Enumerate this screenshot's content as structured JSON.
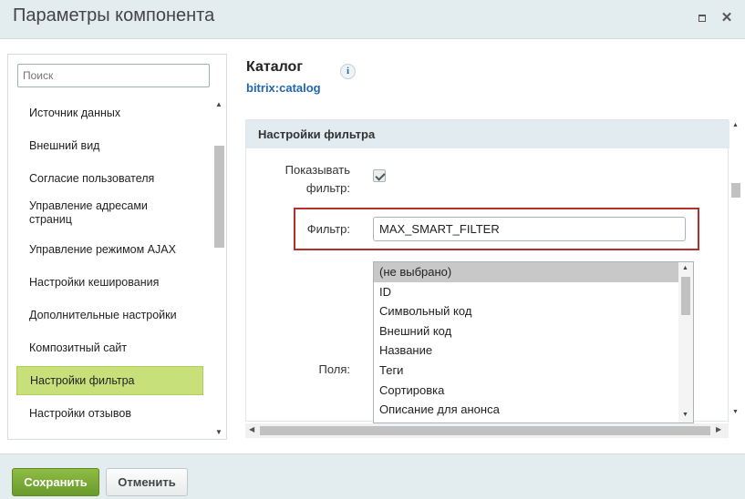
{
  "window": {
    "title": "Параметры компонента"
  },
  "sidebar": {
    "search_placeholder": "Поиск",
    "items": [
      {
        "label": "Источник данных"
      },
      {
        "label": "Внешний вид"
      },
      {
        "label": "Согласие пользователя"
      },
      {
        "label": "Управление адресами страниц"
      },
      {
        "label": "Управление режимом AJAX"
      },
      {
        "label": "Настройки кеширования"
      },
      {
        "label": "Дополнительные настройки"
      },
      {
        "label": "Композитный сайт"
      },
      {
        "label": "Настройки фильтра",
        "active": true
      },
      {
        "label": "Настройки отзывов"
      }
    ]
  },
  "component": {
    "name": "Каталог",
    "code": "bitrix:catalog"
  },
  "section": {
    "title": "Настройки фильтра",
    "show_filter_label": "Показывать фильтр:",
    "show_filter_checked": true,
    "filter_label": "Фильтр:",
    "filter_value": "MAX_SMART_FILTER",
    "fields_label": "Поля:",
    "fields_options": [
      {
        "label": "(не выбрано)",
        "selected": true
      },
      {
        "label": "ID"
      },
      {
        "label": "Символьный код"
      },
      {
        "label": "Внешний код"
      },
      {
        "label": "Название"
      },
      {
        "label": "Теги"
      },
      {
        "label": "Сортировка"
      },
      {
        "label": "Описание для анонса"
      }
    ]
  },
  "footer": {
    "save_label": "Сохранить",
    "cancel_label": "Отменить"
  }
}
